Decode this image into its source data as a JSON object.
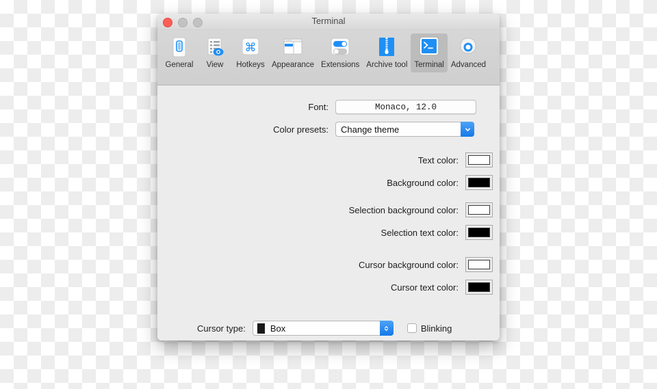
{
  "window": {
    "title": "Terminal",
    "controls": {
      "close": "close-button",
      "minimize": "minimize-button",
      "zoom": "zoom-button"
    }
  },
  "toolbar": {
    "items": [
      {
        "label": "General",
        "icon": "general-icon",
        "selected": false
      },
      {
        "label": "View",
        "icon": "view-icon",
        "selected": false
      },
      {
        "label": "Hotkeys",
        "icon": "hotkeys-icon",
        "selected": false
      },
      {
        "label": "Appearance",
        "icon": "appearance-icon",
        "selected": false
      },
      {
        "label": "Extensions",
        "icon": "extensions-icon",
        "selected": false
      },
      {
        "label": "Archive tool",
        "icon": "archive-tool-icon",
        "selected": false
      },
      {
        "label": "Terminal",
        "icon": "terminal-icon",
        "selected": true
      },
      {
        "label": "Advanced",
        "icon": "advanced-icon",
        "selected": false
      }
    ]
  },
  "form": {
    "font": {
      "label": "Font:",
      "value": "Monaco, 12.0"
    },
    "color_presets": {
      "label": "Color presets:",
      "value": "Change theme"
    },
    "colors": [
      {
        "label": "Text color:",
        "value": "#ffffff"
      },
      {
        "label": "Background color:",
        "value": "#000000"
      },
      {
        "label": "Selection background color:",
        "value": "#ffffff"
      },
      {
        "label": "Selection text color:",
        "value": "#000000"
      },
      {
        "label": "Cursor background color:",
        "value": "#ffffff"
      },
      {
        "label": "Cursor text color:",
        "value": "#000000"
      }
    ],
    "cursor_type": {
      "label": "Cursor type:",
      "value": "Box",
      "swatch": "#1a1a1a"
    },
    "blinking": {
      "label": "Blinking",
      "checked": false
    }
  },
  "theme": {
    "accent": "#1579e8",
    "toolbar_selected": "#bcbcbc",
    "content_bg": "#ececec"
  }
}
